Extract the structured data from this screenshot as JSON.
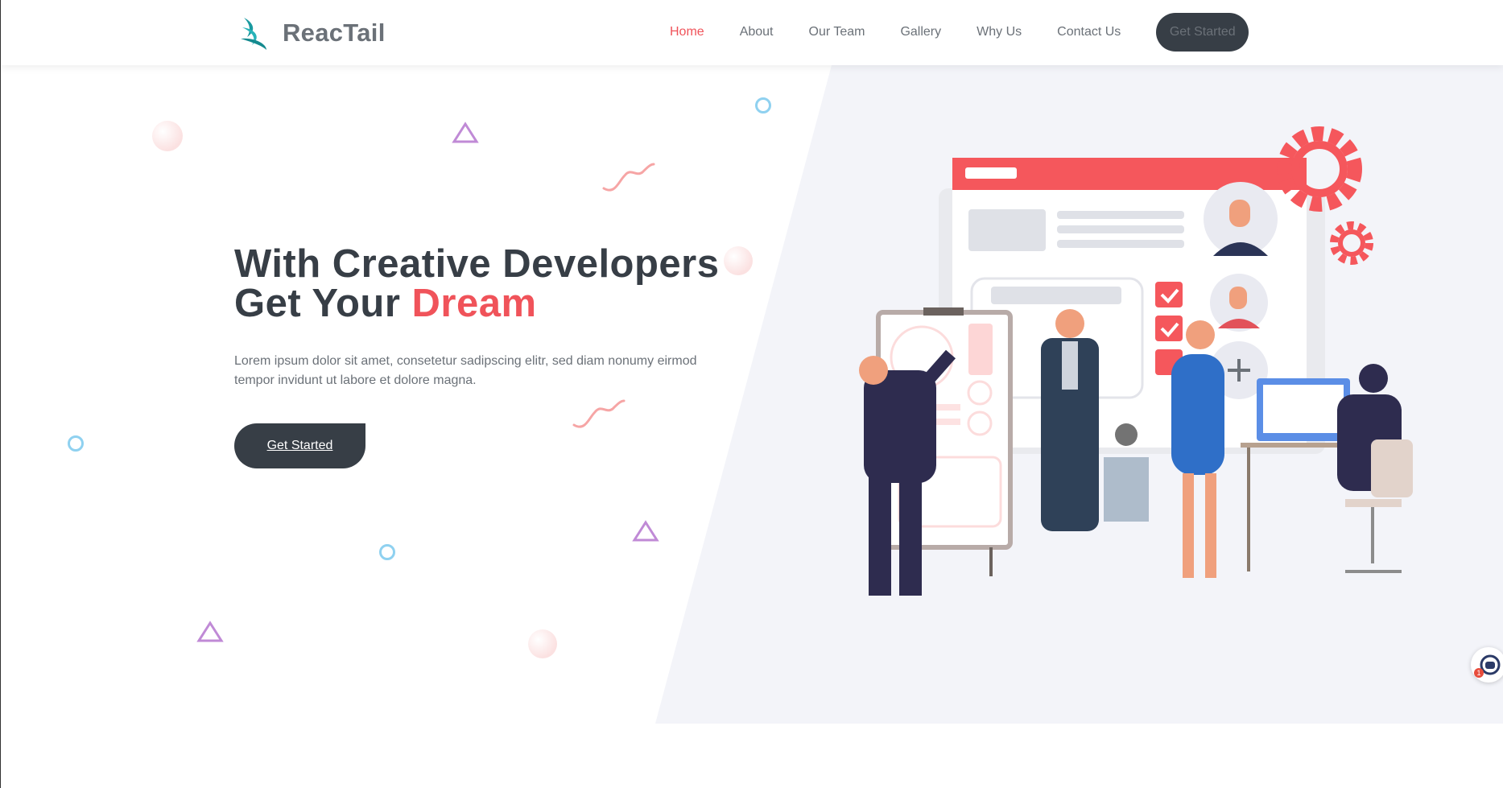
{
  "brand": {
    "name": "ReacTail"
  },
  "nav": {
    "items": [
      {
        "label": "Home",
        "active": true
      },
      {
        "label": "About",
        "active": false
      },
      {
        "label": "Our Team",
        "active": false
      },
      {
        "label": "Gallery",
        "active": false
      },
      {
        "label": "Why Us",
        "active": false
      },
      {
        "label": "Contact Us",
        "active": false
      }
    ],
    "cta_label": "Get Started"
  },
  "hero": {
    "headline_line1": "With Creative Developers",
    "headline_line2_prefix": "Get Your ",
    "headline_accent": "Dream",
    "lead": "Lorem ipsum dolor sit amet, consetetur sadipscing elitr, sed diam nonumy eirmod tempor invidunt ut labore et dolore magna.",
    "cta_label": "Get Started"
  },
  "chat": {
    "badge_count": "1"
  },
  "colors": {
    "accent": "#f0535a",
    "dark": "#373e46",
    "text_muted": "#6b7178",
    "hero_panel": "#f3f4f9",
    "brand_teal": "#1a9aa0"
  },
  "icons": [
    "reactail-logo-icon",
    "chat-support-icon"
  ]
}
